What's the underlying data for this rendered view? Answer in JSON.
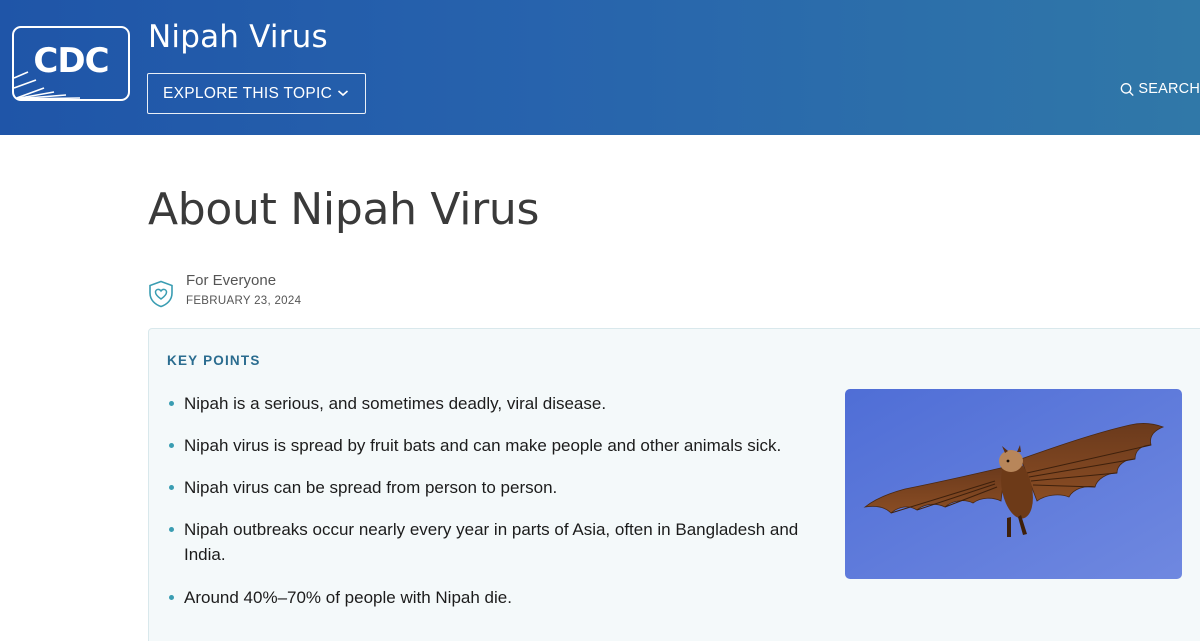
{
  "header": {
    "logo_text": "CDC",
    "site_title": "Nipah Virus",
    "explore_label": "EXPLORE THIS TOPIC",
    "search_label": "SEARCH"
  },
  "main": {
    "page_title": "About Nipah Virus",
    "audience": "For Everyone",
    "date": "FEBRUARY 23, 2024",
    "key_points": {
      "heading": "KEY POINTS",
      "items": [
        "Nipah is a serious, and sometimes deadly, viral disease.",
        "Nipah virus is spread by fruit bats and can make people and other animals sick.",
        "Nipah virus can be spread from person to person.",
        "Nipah outbreaks occur nearly every year in parts of Asia, often in Bangladesh and India.",
        "Around 40%–70% of people with Nipah die."
      ]
    }
  },
  "colors": {
    "header_start": "#1f55a8",
    "header_end": "#3078a8",
    "key_points_heading": "#2a6c8f",
    "bullet": "#3a9db2",
    "key_points_bg": "#f4f9fa"
  },
  "icons": {
    "logo": "cdc-logo",
    "explore": "chevron-down-icon",
    "search": "search-icon",
    "audience": "shield-heart-icon",
    "image": "fruit-bat-photo"
  }
}
